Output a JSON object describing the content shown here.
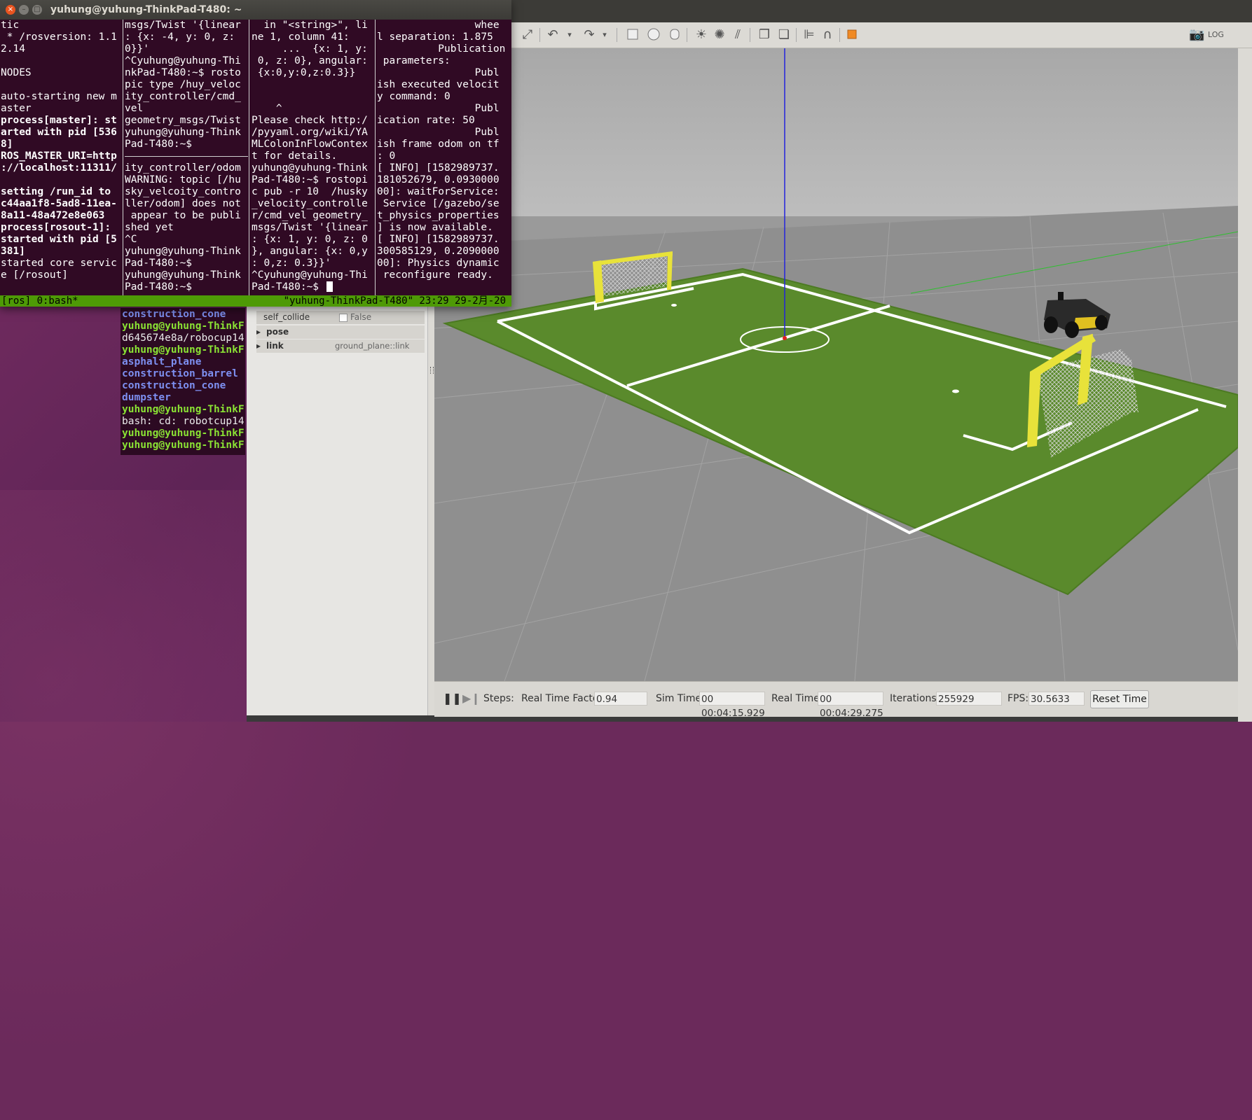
{
  "terminal": {
    "title": "yuhung@yuhung-ThinkPad-T480: ~",
    "panes": [
      {
        "lines": [
          {
            "t": "tic",
            "b": false
          },
          {
            "t": " * /rosversion: 1.1",
            "b": false
          },
          {
            "t": "2.14",
            "b": false
          },
          {
            "t": "",
            "b": false
          },
          {
            "t": "NODES",
            "b": false
          },
          {
            "t": "",
            "b": false
          },
          {
            "t": "auto-starting new m",
            "b": false
          },
          {
            "t": "aster",
            "b": false
          },
          {
            "t": "process[master]: st",
            "b": true
          },
          {
            "t": "arted with pid [536",
            "b": true
          },
          {
            "t": "8]",
            "b": true
          },
          {
            "t": "ROS_MASTER_URI=http",
            "b": true
          },
          {
            "t": "://localhost:11311/",
            "b": true
          },
          {
            "t": "",
            "b": false
          },
          {
            "t": "setting /run_id to",
            "b": true
          },
          {
            "t": "c44aa1f8-5ad8-11ea-",
            "b": true
          },
          {
            "t": "8a11-48a472e8e063",
            "b": true
          },
          {
            "t": "process[rosout-1]:",
            "b": true
          },
          {
            "t": "started with pid [5",
            "b": true
          },
          {
            "t": "381]",
            "b": true
          },
          {
            "t": "started core servic",
            "b": false
          },
          {
            "t": "e [/rosout]",
            "b": false
          }
        ]
      },
      {
        "lines": [
          {
            "t": "msgs/Twist '{linear",
            "b": false
          },
          {
            "t": ": {x: -4, y: 0, z:",
            "b": false
          },
          {
            "t": "0}}'",
            "b": false
          },
          {
            "t": "^Cyuhung@yuhung-Thi",
            "b": false
          },
          {
            "t": "nkPad-T480:~$ rosto",
            "b": false
          },
          {
            "t": "pic type /huy_veloc",
            "b": false
          },
          {
            "t": "ity_controller/cmd_",
            "b": false
          },
          {
            "t": "vel",
            "b": false
          },
          {
            "t": "geometry_msgs/Twist",
            "b": false
          },
          {
            "t": "yuhung@yuhung-Think",
            "b": false
          },
          {
            "t": "Pad-T480:~$",
            "b": false
          },
          {
            "t": "---SEP---",
            "b": false
          },
          {
            "t": "ity_controller/odom",
            "b": false
          },
          {
            "t": "WARNING: topic [/hu",
            "b": false
          },
          {
            "t": "sky_velcoity_contro",
            "b": false
          },
          {
            "t": "ller/odom] does not",
            "b": false
          },
          {
            "t": " appear to be publi",
            "b": false
          },
          {
            "t": "shed yet",
            "b": false
          },
          {
            "t": "^C",
            "b": false
          },
          {
            "t": "yuhung@yuhung-Think",
            "b": false
          },
          {
            "t": "Pad-T480:~$",
            "b": false
          },
          {
            "t": "yuhung@yuhung-Think",
            "b": false
          },
          {
            "t": "Pad-T480:~$",
            "b": false
          }
        ]
      },
      {
        "lines": [
          {
            "t": "  in \"<string>\", li",
            "b": false
          },
          {
            "t": "ne 1, column 41:",
            "b": false
          },
          {
            "t": "     ...  {x: 1, y:",
            "b": false
          },
          {
            "t": " 0, z: 0}, angular:",
            "b": false
          },
          {
            "t": " {x:0,y:0,z:0.3}}",
            "b": false
          },
          {
            "t": "",
            "b": false
          },
          {
            "t": "",
            "b": false
          },
          {
            "t": "    ^",
            "b": false
          },
          {
            "t": "Please check http:/",
            "b": false
          },
          {
            "t": "/pyyaml.org/wiki/YA",
            "b": false
          },
          {
            "t": "MLColonInFlowContex",
            "b": false
          },
          {
            "t": "t for details.",
            "b": false
          },
          {
            "t": "yuhung@yuhung-Think",
            "b": false
          },
          {
            "t": "Pad-T480:~$ rostopi",
            "b": false
          },
          {
            "t": "c pub -r 10  /husky",
            "b": false
          },
          {
            "t": "_velocity_controlle",
            "b": false
          },
          {
            "t": "r/cmd_vel geometry_",
            "b": false
          },
          {
            "t": "msgs/Twist '{linear",
            "b": false
          },
          {
            "t": ": {x: 1, y: 0, z: 0",
            "b": false
          },
          {
            "t": "}, angular: {x: 0,y",
            "b": false
          },
          {
            "t": ": 0,z: 0.3}}'",
            "b": false
          },
          {
            "t": "^Cyuhung@yuhung-Thi",
            "b": false
          },
          {
            "t": "Pad-T480:~$ ",
            "b": false
          }
        ]
      },
      {
        "lines": [
          {
            "t": "                whee",
            "b": false
          },
          {
            "t": "l separation: 1.875",
            "b": false
          },
          {
            "t": "          Publication",
            "b": false
          },
          {
            "t": " parameters:",
            "b": false
          },
          {
            "t": "                Publ",
            "b": false
          },
          {
            "t": "ish executed velocit",
            "b": false
          },
          {
            "t": "y command: 0",
            "b": false
          },
          {
            "t": "                Publ",
            "b": false
          },
          {
            "t": "ication rate: 50",
            "b": false
          },
          {
            "t": "                Publ",
            "b": false
          },
          {
            "t": "ish frame odom on tf",
            "b": false
          },
          {
            "t": ": 0",
            "b": false
          },
          {
            "t": "[ INFO] [1582989737.",
            "b": false
          },
          {
            "t": "181052679, 0.0930000",
            "b": false
          },
          {
            "t": "00]: waitForService:",
            "b": false
          },
          {
            "t": " Service [/gazebo/se",
            "b": false
          },
          {
            "t": "t_physics_properties",
            "b": false
          },
          {
            "t": "] is now available.",
            "b": false
          },
          {
            "t": "[ INFO] [1582989737.",
            "b": false
          },
          {
            "t": "300585129, 0.2090000",
            "b": false
          },
          {
            "t": "00]: Physics dynamic",
            "b": false
          },
          {
            "t": " reconfigure ready.",
            "b": false
          }
        ]
      }
    ],
    "status_left": "[ros] 0:bash*",
    "status_right": "\"yuhung-ThinkPad-T480\" 23:29 29-2月-20"
  },
  "bg_terminal": {
    "lines": [
      {
        "t": "construction_cone",
        "c": "blue"
      },
      {
        "t": "yuhung@yuhung-ThinkF",
        "c": "green"
      },
      {
        "t": "d645674e8a/robocup14",
        "c": "white"
      },
      {
        "t": "yuhung@yuhung-ThinkF",
        "c": "green"
      },
      {
        "t": "asphalt_plane",
        "c": "blue"
      },
      {
        "t": "construction_barrel",
        "c": "blue"
      },
      {
        "t": "construction_cone",
        "c": "blue"
      },
      {
        "t": "dumpster",
        "c": "blue"
      },
      {
        "t": "yuhung@yuhung-ThinkF",
        "c": "green"
      },
      {
        "t": "bash: cd: robotcup14",
        "c": "white"
      },
      {
        "t": "yuhung@yuhung-ThinkF",
        "c": "green"
      },
      {
        "t": "yuhung@yuhung-ThinkF",
        "c": "green"
      }
    ]
  },
  "gazebo": {
    "properties": [
      {
        "key": "self_collide",
        "value": "False",
        "checkbox": true
      },
      {
        "key": "pose",
        "value": "",
        "expandable": true
      },
      {
        "key": "link",
        "value": "ground_plane::link",
        "expandable": true
      }
    ],
    "status": {
      "steps_label": "Steps:",
      "rtf_label": "Real Time Factor:",
      "rtf_value": "0.94",
      "sim_time_label": "Sim Time:",
      "sim_time_value": "00 00:04:15.929",
      "real_time_label": "Real Time:",
      "real_time_value": "00 00:04:29.275",
      "iterations_label": "Iterations:",
      "iterations_value": "255929",
      "fps_label": "FPS:",
      "fps_value": "30.5633",
      "reset_button": "Reset Time"
    },
    "toolbar_icons": [
      "select-icon",
      "translate-icon",
      "rotate-icon",
      "scale-icon",
      "undo-icon",
      "redo-icon",
      "box-icon",
      "sphere-icon",
      "cylinder-icon",
      "point-light-icon",
      "spot-light-icon",
      "directional-light-icon",
      "copy-icon",
      "paste-icon",
      "align-icon",
      "snap-icon",
      "view-angle-icon",
      "screenshot-icon",
      "log-icon"
    ],
    "colors": {
      "grass": "#557f2a",
      "goal": "#e8e23a",
      "floor": "#8e8e8e",
      "sky": "#b4b4b4"
    }
  }
}
